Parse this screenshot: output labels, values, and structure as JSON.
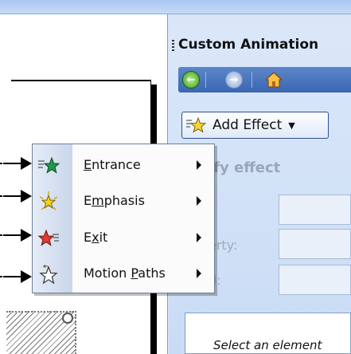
{
  "task_pane": {
    "title": "Custom Animation",
    "add_effect_label": "Add Effect",
    "modify_label": "ify effect",
    "field_labels": [
      ":",
      "erty:",
      "d:"
    ],
    "select_message": "Select an element"
  },
  "menu": {
    "items": [
      {
        "pre": "",
        "ul": "E",
        "post": "ntrance",
        "icon": "entrance-star-icon"
      },
      {
        "pre": "E",
        "ul": "m",
        "post": "phasis",
        "icon": "emphasis-star-icon"
      },
      {
        "pre": "E",
        "ul": "x",
        "post": "it",
        "icon": "exit-star-icon"
      },
      {
        "pre": "Motion ",
        "ul": "P",
        "post": "aths",
        "icon": "motion-path-star-icon"
      }
    ]
  },
  "colors": {
    "nav_bar": "#3a66b2",
    "entrance": "#1f9a4a",
    "emphasis": "#f2d21b",
    "exit": "#e23b2e"
  }
}
